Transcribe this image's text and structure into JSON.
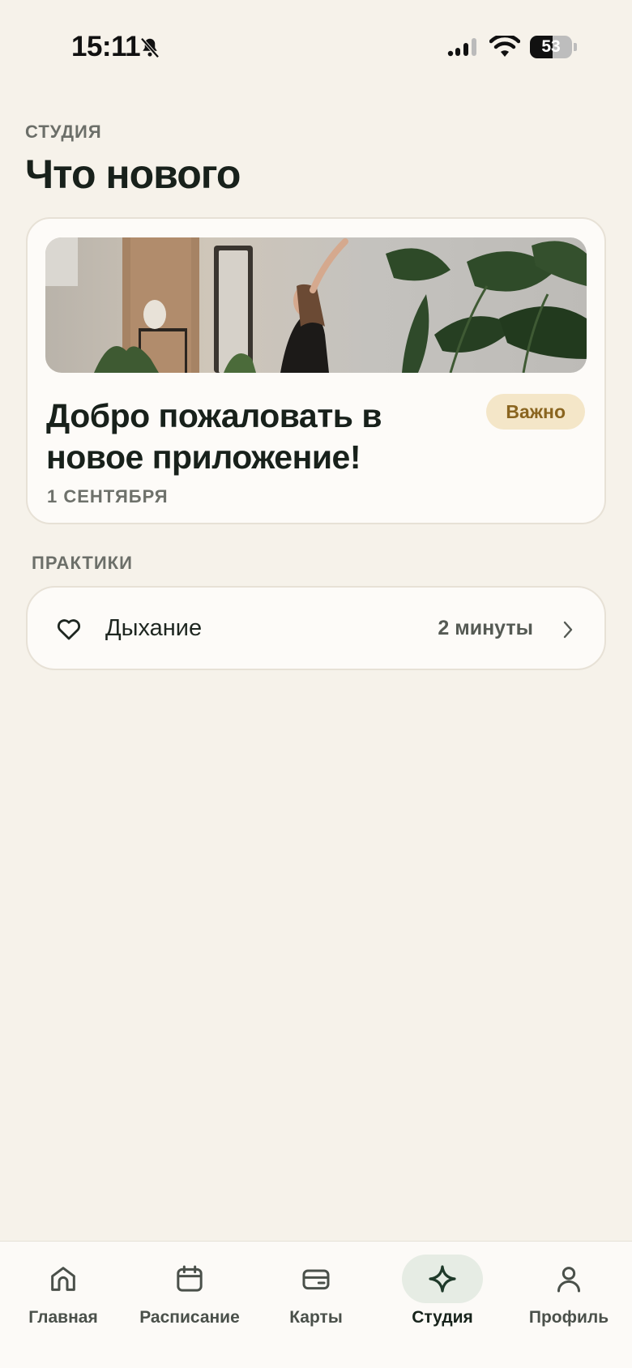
{
  "status_bar": {
    "time": "15:11",
    "battery": "53",
    "battery_level": 0.53
  },
  "header": {
    "eyebrow": "СТУДИЯ",
    "title": "Что нового"
  },
  "news": {
    "headline": "Добро пожаловать в новое приложение!",
    "badge": "Важно",
    "date": "1 СЕНТЯБРЯ"
  },
  "practices": {
    "section_label": "ПРАКТИКИ",
    "items": [
      {
        "name": "Дыхание",
        "duration": "2 минуты",
        "icon": "heart-icon"
      }
    ]
  },
  "tabbar": {
    "active": "studio",
    "tabs": [
      {
        "id": "home",
        "label": "Главная",
        "icon": "home-icon"
      },
      {
        "id": "schedule",
        "label": "Расписание",
        "icon": "calendar-icon"
      },
      {
        "id": "cards",
        "label": "Карты",
        "icon": "card-icon"
      },
      {
        "id": "studio",
        "label": "Студия",
        "icon": "sparkle-icon"
      },
      {
        "id": "profile",
        "label": "Профиль",
        "icon": "person-icon"
      }
    ]
  },
  "colors": {
    "background": "#F6F2EA",
    "card": "#FDFBF8",
    "badge_bg": "#F4E6C8",
    "badge_text": "#8A6520",
    "active_tab_bg": "#E6ECE4",
    "accent": "#1F3A2A"
  }
}
